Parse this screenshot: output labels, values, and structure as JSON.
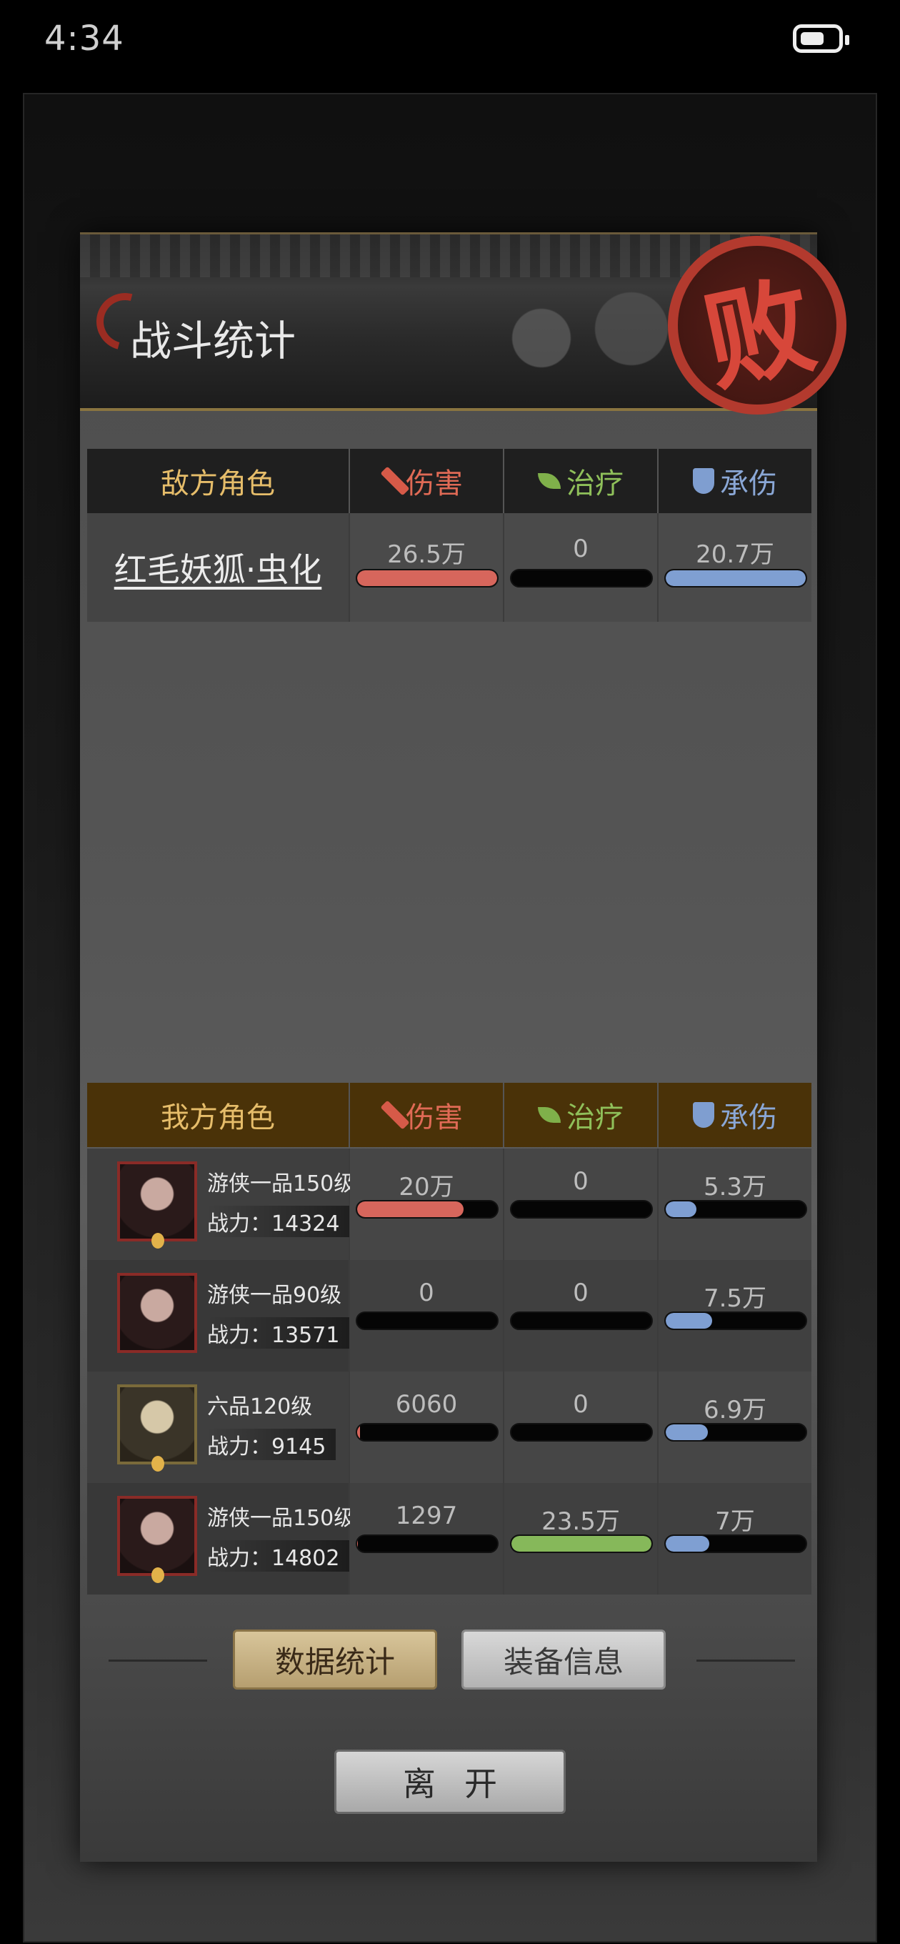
{
  "status_bar": {
    "time": "4:34"
  },
  "dialog": {
    "title": "战斗统计",
    "seal_text": "败"
  },
  "columns": {
    "damage": "伤害",
    "heal": "治疗",
    "taken": "承伤"
  },
  "enemy": {
    "header": "敌方角色",
    "rows": [
      {
        "name": "红毛妖狐·虫化",
        "damage": "26.5万",
        "heal": "0",
        "taken": "20.7万",
        "damage_frac": 1.0,
        "heal_frac": 0,
        "taken_frac": 1.0
      }
    ]
  },
  "ally": {
    "header": "我方角色",
    "rows": [
      {
        "class": "游侠一品150级",
        "power": "战力：14324",
        "damage": "20万",
        "heal": "0",
        "taken": "5.3万",
        "damage_frac": 0.76,
        "heal_frac": 0,
        "taken_frac": 0.22
      },
      {
        "class": "游侠一品90级",
        "power": "战力：13571",
        "damage": "0",
        "heal": "0",
        "taken": "7.5万",
        "damage_frac": 0,
        "heal_frac": 0,
        "taken_frac": 0.33
      },
      {
        "class": "六品120级",
        "power": "战力：9145",
        "damage": "6060",
        "heal": "0",
        "taken": "6.9万",
        "damage_frac": 0.02,
        "heal_frac": 0,
        "taken_frac": 0.3
      },
      {
        "class": "游侠一品150级",
        "power": "战力：14802",
        "damage": "1297",
        "heal": "23.5万",
        "taken": "7万",
        "damage_frac": 0.005,
        "heal_frac": 1.0,
        "taken_frac": 0.31
      }
    ]
  },
  "tabs": {
    "stats": "数据统计",
    "equip": "装备信息"
  },
  "leave_button": "离开",
  "colors": {
    "damage": "#d7665c",
    "heal": "#86b85a",
    "taken": "#7f9fd2",
    "ally_header_bg": "#4a3208"
  }
}
